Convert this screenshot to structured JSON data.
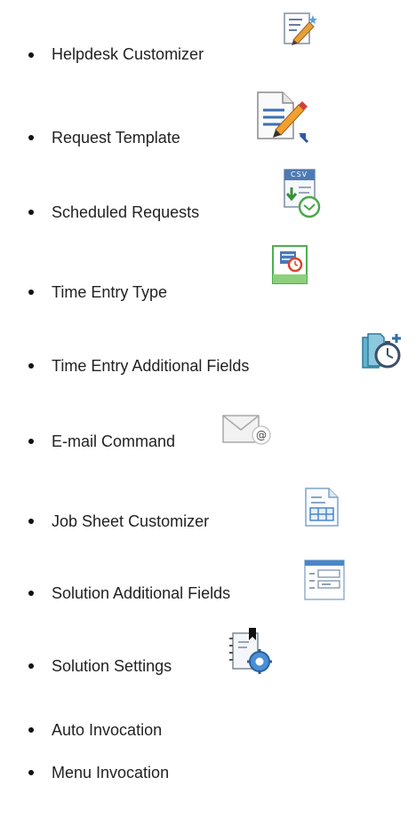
{
  "items": [
    {
      "label": "Helpdesk Customizer",
      "icon": "helpdesk-customizer-icon"
    },
    {
      "label": "Request Template",
      "icon": "request-template-icon"
    },
    {
      "label": "Scheduled Requests",
      "icon": "scheduled-requests-icon"
    },
    {
      "label": "Time Entry Type",
      "icon": "time-entry-type-icon"
    },
    {
      "label": "Time Entry Additional Fields",
      "icon": "time-entry-additional-fields-icon"
    },
    {
      "label": "E-mail Command",
      "icon": "email-command-icon"
    },
    {
      "label": "Job Sheet Customizer",
      "icon": "job-sheet-customizer-icon"
    },
    {
      "label": "Solution Additional Fields",
      "icon": "solution-additional-fields-icon"
    },
    {
      "label": "Solution Settings",
      "icon": "solution-settings-icon"
    },
    {
      "label": "Auto Invocation",
      "icon": ""
    },
    {
      "label": "Menu Invocation",
      "icon": ""
    }
  ],
  "icon_text": {
    "csv": "CSV"
  }
}
